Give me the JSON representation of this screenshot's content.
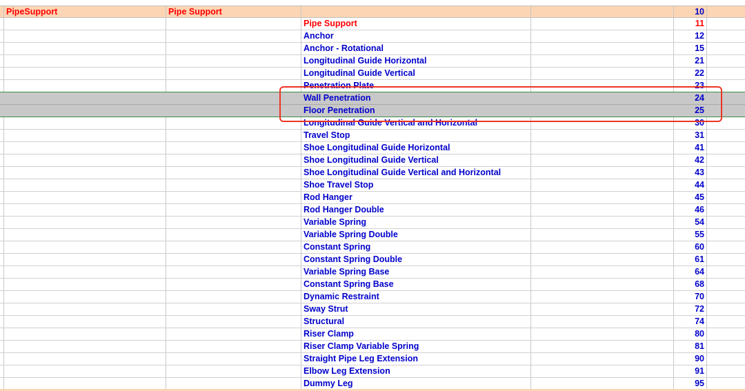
{
  "header_row": {
    "col1": "PipeSupport",
    "col2": "Pipe Support",
    "code": "10"
  },
  "rows": [
    {
      "name": "Pipe Support",
      "code": "11",
      "highlight": "red"
    },
    {
      "name": "Anchor",
      "code": "12"
    },
    {
      "name": "Anchor - Rotational",
      "code": "15"
    },
    {
      "name": "Longitudinal Guide Horizontal",
      "code": "21"
    },
    {
      "name": "Longitudinal Guide Vertical",
      "code": "22"
    },
    {
      "name": "Penetration Plate",
      "code": "23"
    },
    {
      "name": "Wall Penetration",
      "code": "24",
      "selected": true
    },
    {
      "name": "Floor Penetration",
      "code": "25",
      "selected": true
    },
    {
      "name": "Longitudinal Guide Vertical and Horizontal",
      "code": "30"
    },
    {
      "name": "Travel Stop",
      "code": "31"
    },
    {
      "name": "Shoe Longitudinal Guide Horizontal",
      "code": "41"
    },
    {
      "name": "Shoe Longitudinal Guide Vertical",
      "code": "42"
    },
    {
      "name": "Shoe Longitudinal Guide Vertical and Horizontal",
      "code": "43"
    },
    {
      "name": "Shoe Travel Stop",
      "code": "44"
    },
    {
      "name": "Rod Hanger",
      "code": "45"
    },
    {
      "name": "Rod Hanger Double",
      "code": "46"
    },
    {
      "name": "Variable Spring",
      "code": "54"
    },
    {
      "name": "Variable Spring Double",
      "code": "55"
    },
    {
      "name": "Constant Spring",
      "code": "60"
    },
    {
      "name": "Constant Spring Double",
      "code": "61"
    },
    {
      "name": "Variable Spring Base",
      "code": "64"
    },
    {
      "name": "Constant Spring Base",
      "code": "68"
    },
    {
      "name": "Dynamic Restraint",
      "code": "70"
    },
    {
      "name": "Sway Strut",
      "code": "72"
    },
    {
      "name": "Structural",
      "code": "74"
    },
    {
      "name": "Riser Clamp",
      "code": "80"
    },
    {
      "name": "Riser Clamp Variable Spring",
      "code": "81"
    },
    {
      "name": "Straight Pipe Leg Extension",
      "code": "90"
    },
    {
      "name": "Elbow Leg Extension",
      "code": "91"
    },
    {
      "name": "Dummy Leg",
      "code": "95"
    }
  ],
  "colors": {
    "header_fill": "#fcd5b4",
    "header_text": "#ff0000",
    "item_text": "#0000cc",
    "selection_fill": "#c8c8c8",
    "annotation_box": "#ee3322"
  }
}
